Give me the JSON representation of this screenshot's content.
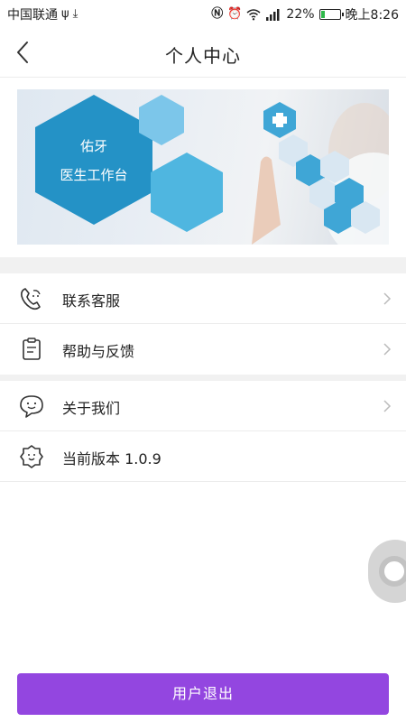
{
  "status_bar": {
    "carrier": "中国联通",
    "battery": "22%",
    "time": "晚上8:26",
    "battery_level": 0.22
  },
  "header": {
    "title": "个人中心",
    "back_icon": "chevron-left-icon"
  },
  "banner": {
    "brand": "佑牙",
    "subtitle": "医生工作台",
    "colors": {
      "hex_dark": "#2492c6",
      "hex_light": "#4fb6e0"
    }
  },
  "menu": {
    "items": [
      {
        "label": "联系客服",
        "icon": "customer-service-icon"
      },
      {
        "label": "帮助与反馈",
        "icon": "feedback-icon"
      },
      {
        "label": "关于我们",
        "icon": "chat-smile-icon"
      },
      {
        "label": "当前版本 1.0.9",
        "icon": "gear-smile-icon"
      }
    ]
  },
  "logout": {
    "label": "用户退出",
    "color": "#9346e0"
  }
}
